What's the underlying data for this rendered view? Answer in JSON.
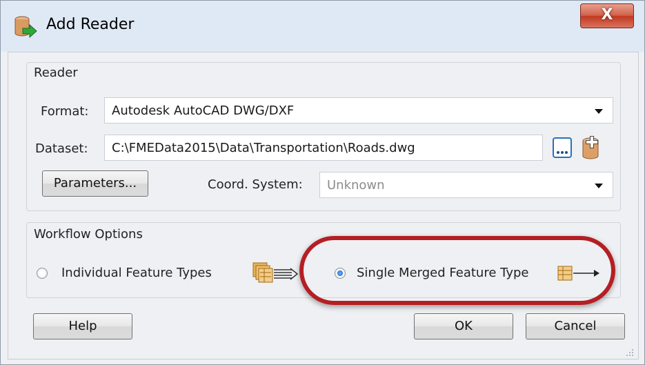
{
  "window": {
    "title": "Add Reader",
    "close_label": "X"
  },
  "reader_group": {
    "label": "Reader",
    "format": {
      "label": "Format:",
      "value": "Autodesk AutoCAD DWG/DXF"
    },
    "dataset": {
      "label": "Dataset:",
      "value": "C:\\FMEData2015\\Data\\Transportation\\Roads.dwg",
      "browse_label": "..."
    },
    "parameters_label": "Parameters...",
    "coord_system": {
      "label": "Coord. System:",
      "value": "Unknown"
    }
  },
  "workflow_group": {
    "label": "Workflow Options",
    "options": [
      {
        "label": "Individual Feature Types",
        "selected": false
      },
      {
        "label": "Single Merged Feature Type",
        "selected": true
      }
    ]
  },
  "buttons": {
    "help": "Help",
    "ok": "OK",
    "cancel": "Cancel"
  },
  "colors": {
    "accent_ring": "#b41f24",
    "title_bg": "#dfe9f5",
    "dialog_bg": "#eef0f3"
  }
}
